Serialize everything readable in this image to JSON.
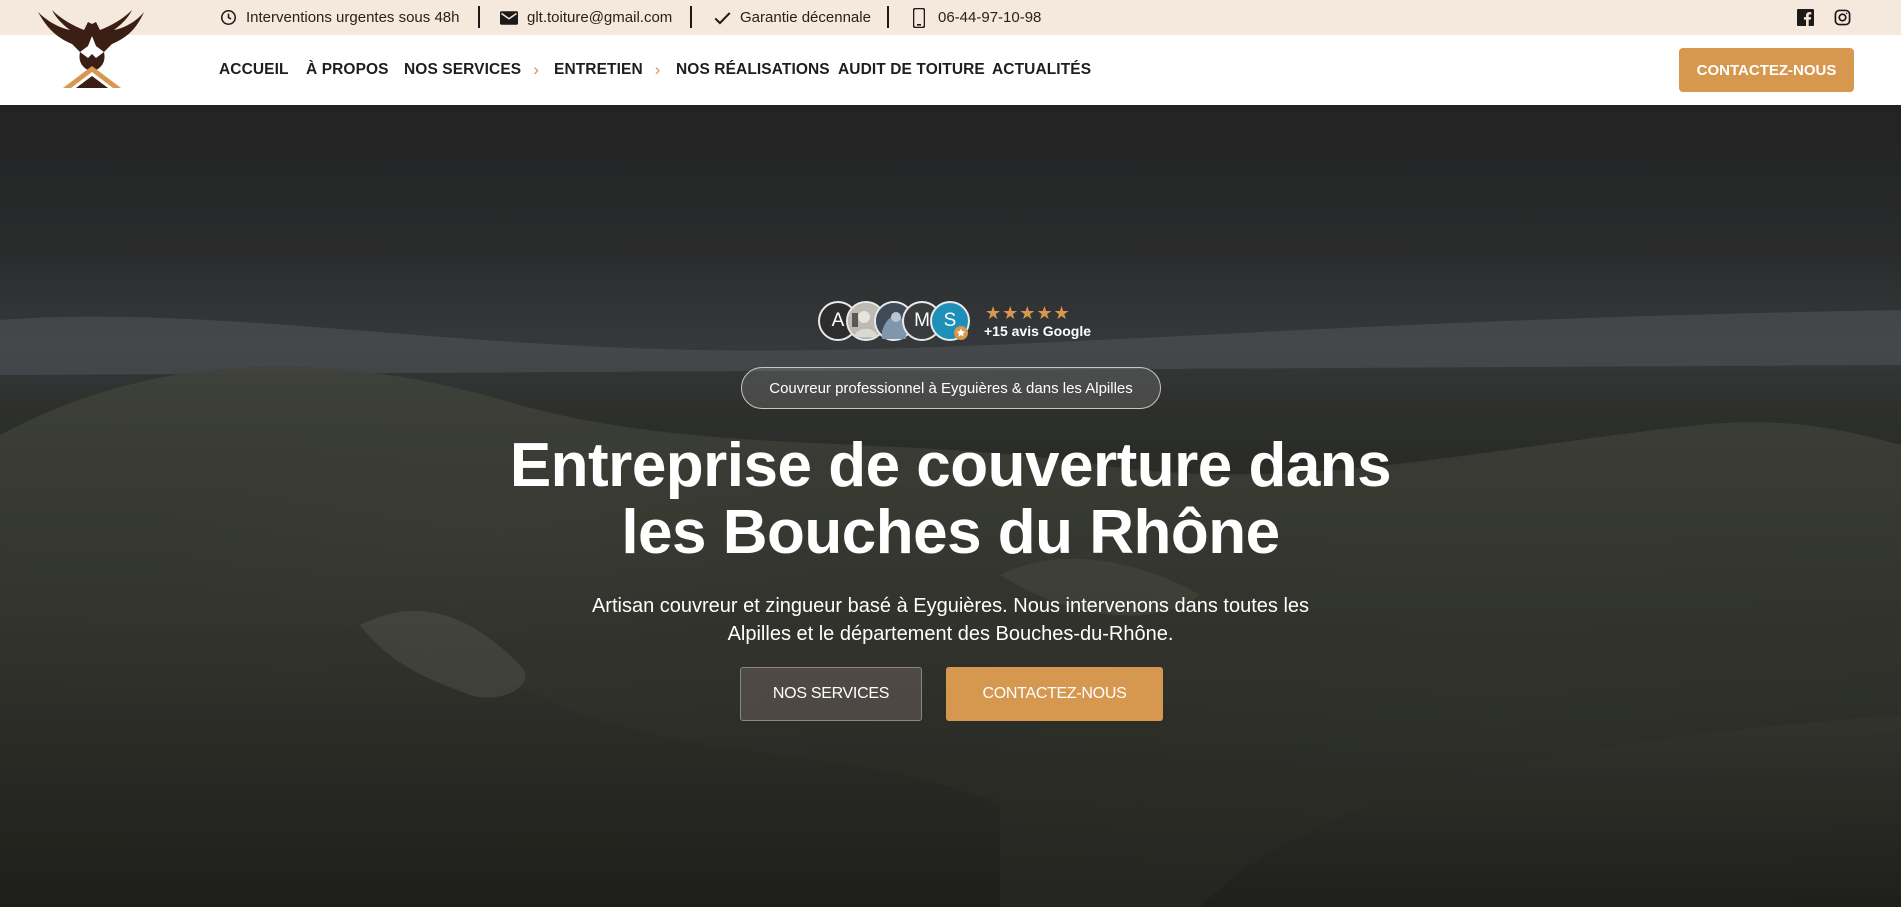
{
  "topbar": {
    "urgent": "Interventions urgentes sous 48h",
    "email": "glt.toiture@gmail.com",
    "guarantee": "Garantie décennale",
    "phone": "06-44-97-10-98"
  },
  "nav": {
    "items": [
      {
        "label": "ACCUEIL",
        "dropdown": false
      },
      {
        "label": "À PROPOS",
        "dropdown": false
      },
      {
        "label": "NOS SERVICES",
        "dropdown": true
      },
      {
        "label": "ENTRETIEN",
        "dropdown": true
      },
      {
        "label": "NOS RÉALISATIONS",
        "dropdown": false
      },
      {
        "label": "AUDIT DE TOITURE",
        "dropdown": false
      },
      {
        "label": "ACTUALITÉS",
        "dropdown": false
      }
    ],
    "cta": "CONTACTEZ-NOUS"
  },
  "hero": {
    "avatars": [
      "A",
      "",
      "",
      "M",
      "S"
    ],
    "stars": "★★★★★",
    "reviews": "+15 avis Google",
    "badge": "Couvreur professionnel à Eyguières & dans les Alpilles",
    "title_line1": "Entreprise de couverture dans",
    "title_line2": "les Bouches du Rhône",
    "lead_line1": "Artisan couvreur et zingueur basé à Eyguières. Nous intervenons dans toutes les",
    "lead_line2": "Alpilles et le département des Bouches-du-Rhône.",
    "btn_services": "NOS SERVICES",
    "btn_contact": "CONTACTEZ-NOUS"
  },
  "colors": {
    "accent": "#d6984f",
    "topbar_bg": "#f5e8dc",
    "logo_brown": "#3b1e14"
  },
  "icons": {
    "urgent": "clock-icon",
    "email": "envelope-icon",
    "guarantee": "check-icon",
    "phone": "phone-icon",
    "social": [
      "facebook-icon",
      "instagram-icon"
    ],
    "review": "google-star-badge-icon"
  }
}
